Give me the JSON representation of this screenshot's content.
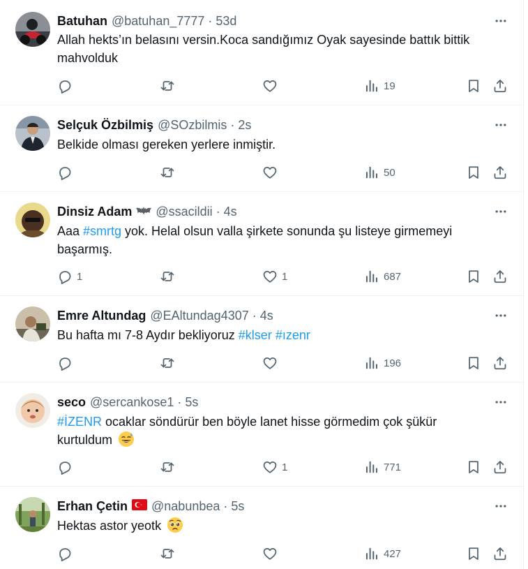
{
  "tweets": [
    {
      "name": "Batuhan",
      "handle": "@batuhan_7777",
      "separator": "·",
      "time": "53d",
      "text_parts": [
        "Allah hekts’ın belasını versin.Koca sandığımız Oyak sayesinde battık bittik",
        "mahvolduk"
      ],
      "replies": "",
      "retweets": "",
      "likes": "",
      "views": "19"
    },
    {
      "name": "Selçuk Özbilmiş",
      "handle": "@SOzbilmis",
      "separator": "·",
      "time": "2s",
      "text": "Belkide olması gereken yerlere inmiştir.",
      "replies": "",
      "retweets": "",
      "likes": "",
      "views": "50"
    },
    {
      "name": "Dinsiz Adam",
      "badge_icon": "bat-icon",
      "handle": "@ssacildii",
      "separator": "·",
      "time": "4s",
      "text_pre": "Aaa ",
      "hashtag1": "#smrtg",
      "text_post": " yok. Helal olsun valla şirkete sonunda şu listeye girmemeyi",
      "text_line2": "başarmış.",
      "replies": "1",
      "retweets": "",
      "likes": "1",
      "views": "687"
    },
    {
      "name": "Emre Altundag",
      "handle": "@EAltundag4307",
      "separator": "·",
      "time": "4s",
      "text_pre": "Bu hafta mı 7-8 Aydır bekliyoruz ",
      "hashtag1": "#klser",
      "text_mid": " ",
      "hashtag2": "#ızenr",
      "replies": "",
      "retweets": "",
      "likes": "",
      "views": "196"
    },
    {
      "name": "seco",
      "handle": "@sercankose1",
      "separator": "·",
      "time": "5s",
      "hashtag1": "#İZENR",
      "text_post": " ocaklar söndürür ben böyle lanet hisse görmedim çok şükür",
      "text_line2": "kurtuldum",
      "emoji": "sweat-smile-emoji",
      "replies": "",
      "retweets": "",
      "likes": "1",
      "views": "771"
    },
    {
      "name": "Erhan Çetin",
      "badge_icon": "turkey-flag-icon",
      "handle": "@nabunbea",
      "separator": "·",
      "time": "5s",
      "text": "Hektas astor yeotk",
      "emoji": "pleading-face-emoji",
      "replies": "",
      "retweets": "",
      "likes": "",
      "views": "427"
    }
  ],
  "colors": {
    "text": "#0f1419",
    "muted": "#536471",
    "link": "#1d9bf0",
    "divider": "#eff3f4",
    "flag": "#e30a17"
  },
  "icons": [
    "more-icon",
    "reply-icon",
    "retweet-icon",
    "like-icon",
    "views-icon",
    "bookmark-icon",
    "share-icon"
  ]
}
